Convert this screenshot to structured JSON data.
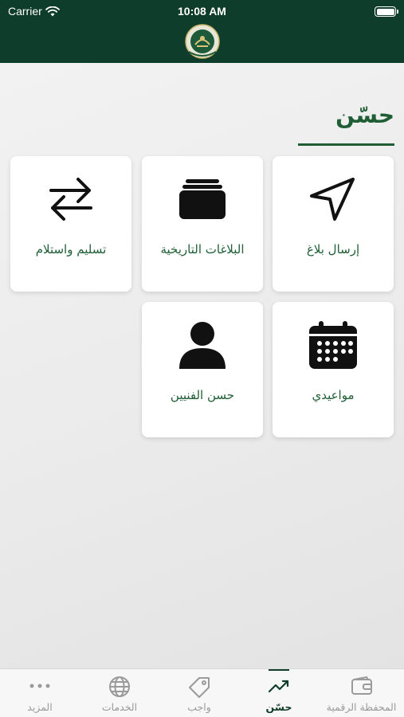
{
  "status_bar": {
    "carrier": "Carrier",
    "time": "10:08 AM"
  },
  "header": {
    "logo_icon": "emblem-icon"
  },
  "page": {
    "title": "حسّن"
  },
  "tiles": [
    {
      "label": "إرسال بلاغ",
      "icon": "navigation-arrow-icon"
    },
    {
      "label": "البلاغات التاريخية",
      "icon": "stack-icon"
    },
    {
      "label": "تسليم واستلام",
      "icon": "swap-arrows-icon"
    },
    {
      "label": "مواعيدي",
      "icon": "calendar-icon"
    },
    {
      "label": "حسن الفنيين",
      "icon": "person-icon"
    }
  ],
  "tab_bar": {
    "tabs": [
      {
        "label": "المحفظة الرقمية",
        "icon": "wallet-icon"
      },
      {
        "label": "حسّن",
        "icon": "trending-up-icon"
      },
      {
        "label": "واجب",
        "icon": "tag-icon"
      },
      {
        "label": "الخدمات",
        "icon": "globe-icon"
      },
      {
        "label": "المزيد",
        "icon": "more-dots-icon"
      }
    ],
    "active_index": 1
  },
  "colors": {
    "primary": "#0f3d2c",
    "accent_text": "#1f5e35",
    "inactive": "#9a9a9a"
  }
}
